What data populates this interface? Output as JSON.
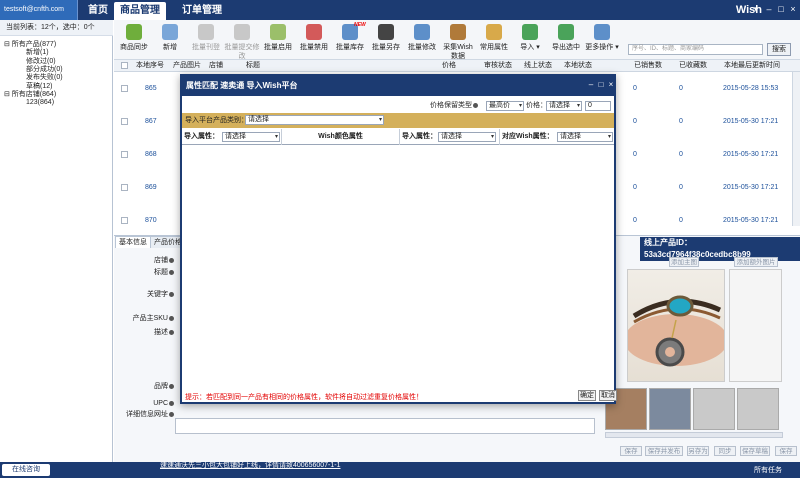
{
  "account": "testsoft@cnfth.com",
  "nav": {
    "tabs": [
      "首页",
      "商品管理",
      "订单管理"
    ],
    "active_index": 1
  },
  "brand": "Wish",
  "window_controls": [
    "▾",
    "–",
    "□",
    "×"
  ],
  "sidebar": {
    "summary": "当前列表：12个，选中：0个",
    "tree": [
      {
        "label": "所有产品(877)",
        "level": 0,
        "toggle": "⊟"
      },
      {
        "label": "新增(1)",
        "level": 1
      },
      {
        "label": "修改过(0)",
        "level": 1
      },
      {
        "label": "部分成功(0)",
        "level": 1
      },
      {
        "label": "发布失败(0)",
        "level": 1
      },
      {
        "label": "草稿(12)",
        "level": 1
      },
      {
        "label": "所有店铺(864)",
        "level": 0,
        "toggle": "⊟"
      },
      {
        "label": "123(864)",
        "level": 1
      }
    ]
  },
  "toolbar": {
    "buttons": [
      {
        "label": "商品同步",
        "icon": "sync-icon",
        "color": "#6fae3c",
        "enabled": true
      },
      {
        "label": "新增",
        "icon": "add-icon",
        "color": "#7aa6d8",
        "enabled": true
      },
      {
        "label": "批量刊登",
        "icon": "publish-icon",
        "color": "#c8c8c8",
        "enabled": false
      },
      {
        "label": "批量提交修改",
        "icon": "submit-icon",
        "color": "#c8c8c8",
        "enabled": false
      },
      {
        "label": "批量启用",
        "icon": "enable-icon",
        "color": "#9bbf6a",
        "enabled": true
      },
      {
        "label": "批量禁用",
        "icon": "disable-icon",
        "color": "#d35a5a",
        "enabled": true
      },
      {
        "label": "批量库存",
        "icon": "inventory-icon",
        "color": "#5d8fc9",
        "enabled": true,
        "badge": "NEW"
      },
      {
        "label": "批量另存",
        "icon": "save-as-icon",
        "color": "#444444",
        "enabled": true
      },
      {
        "label": "批量修改",
        "icon": "edit-icon",
        "color": "#5d8fc9",
        "enabled": true
      },
      {
        "label": "采集Wish数据",
        "icon": "collect-icon",
        "color": "#b07a3a",
        "enabled": true
      },
      {
        "label": "常用属性",
        "icon": "attribute-icon",
        "color": "#d8a94a",
        "enabled": true
      },
      {
        "label": "导入",
        "icon": "import-icon",
        "color": "#4aa35a",
        "enabled": true,
        "dropdown": true
      },
      {
        "label": "导出选中",
        "icon": "export-icon",
        "color": "#4aa35a",
        "enabled": true
      },
      {
        "label": "更多操作",
        "icon": "more-icon",
        "color": "#5d8fc9",
        "enabled": true,
        "dropdown": true
      }
    ],
    "search_placeholder": "序号、ID、标题、商家编码",
    "search_button": "搜索"
  },
  "grid": {
    "columns": [
      "本地序号",
      "产品图片",
      "店铺",
      "标题",
      "价格",
      "审核状态",
      "线上状态",
      "本地状态",
      "已销售数",
      "已收藏数",
      "本地最后更新时间"
    ],
    "rows": [
      {
        "seq": "865",
        "sold": "0",
        "fav": "0",
        "updated": "2015-05-28 15:53"
      },
      {
        "seq": "867",
        "sold": "0",
        "fav": "0",
        "updated": "2015-05-30 17:21"
      },
      {
        "seq": "868",
        "sold": "0",
        "fav": "0",
        "updated": "2015-05-30 17:21"
      },
      {
        "seq": "869",
        "sold": "0",
        "fav": "0",
        "updated": "2015-05-30 17:21"
      },
      {
        "seq": "870",
        "sold": "0",
        "fav": "0",
        "updated": "2015-05-30 17:21"
      }
    ]
  },
  "detail": {
    "tabs": [
      "基本信息",
      "产品价格"
    ],
    "product_id": "线上产品ID：53a3cd7964f38c0cedbc8b99",
    "fields": [
      "店铺",
      "标题",
      "关键字",
      "产品主SKU",
      "描述",
      "品牌",
      "UPC",
      "详细信息网址"
    ],
    "image_buttons": [
      "添加主图",
      "添加额外图片"
    ],
    "actions": [
      "保存",
      "保存并发布",
      "另存为",
      "同步",
      "保存草稿",
      "保存"
    ]
  },
  "modal": {
    "title": "属性匹配    速卖通 导入Wish平台",
    "controls": [
      "–",
      "□",
      "×"
    ],
    "price_label": "价格保留类型",
    "price_type": "最高价",
    "price_label2": "价格：",
    "price_select": "请选择",
    "price_value": "0",
    "category_label": "导入平台产品类别：",
    "category_select": "请选择",
    "map_headers": [
      {
        "label": "导入属性：",
        "select": "请选择"
      },
      {
        "label": "Wish颜色属性",
        "select": ""
      },
      {
        "label": "导入属性：",
        "select": "请选择"
      },
      {
        "label": "对应Wish属性：",
        "select": "请选择"
      }
    ],
    "hint": "提示：若匹配到同一产品有相同的价格属性，软件将自动过滤重复价格属性！",
    "ok": "确定",
    "cancel": "取消"
  },
  "status": {
    "online": "在线咨询",
    "notice": "速速通沃先三小包大包铺好上线，详情请致400656007-1-1",
    "tasks": "所有任务"
  }
}
